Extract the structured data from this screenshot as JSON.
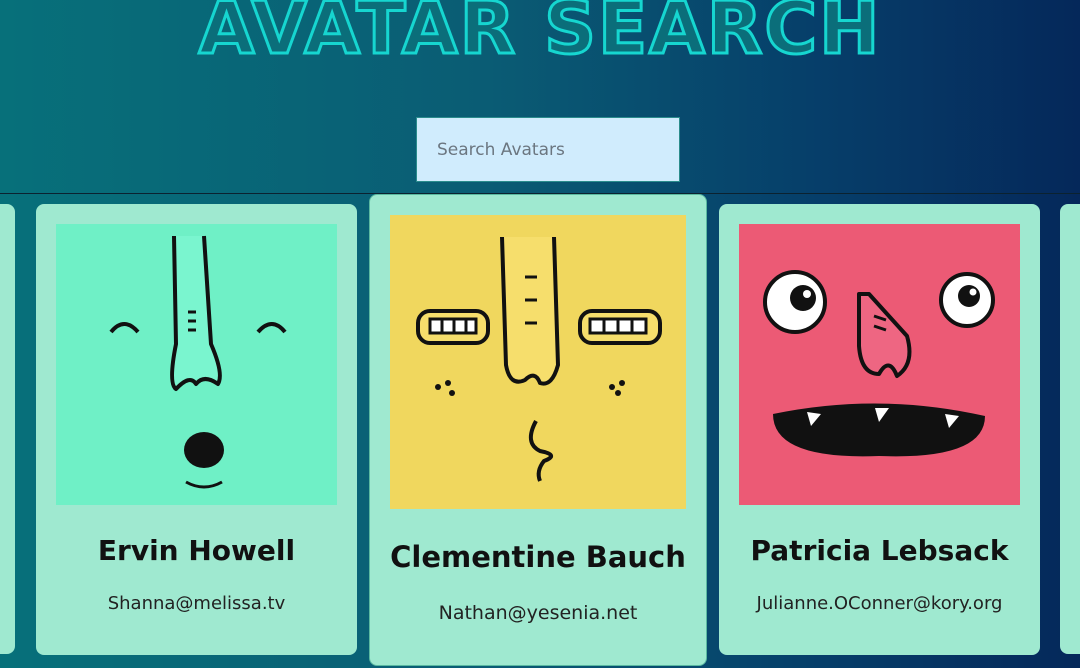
{
  "header": {
    "title": "AVATAR SEARCH"
  },
  "search": {
    "placeholder": "Search Avatars",
    "value": ""
  },
  "cards": [
    {
      "name": "",
      "email": "",
      "avatar_color": "#9fe9d0"
    },
    {
      "name": "Ervin Howell",
      "email": "Shanna@melissa.tv",
      "avatar_color": "#6ff0c6"
    },
    {
      "name": "Clementine Bauch",
      "email": "Nathan@yesenia.net",
      "avatar_color": "#f0d75e"
    },
    {
      "name": "Patricia Lebsack",
      "email": "Julianne.OConner@kory.org",
      "avatar_color": "#ec5a75"
    },
    {
      "name": "",
      "email": "",
      "avatar_color": "#9fe9d0"
    }
  ],
  "colors": {
    "card": "#9fe9d0",
    "search_bg": "#d0ecfd",
    "title_outline": "#16d6d0"
  }
}
